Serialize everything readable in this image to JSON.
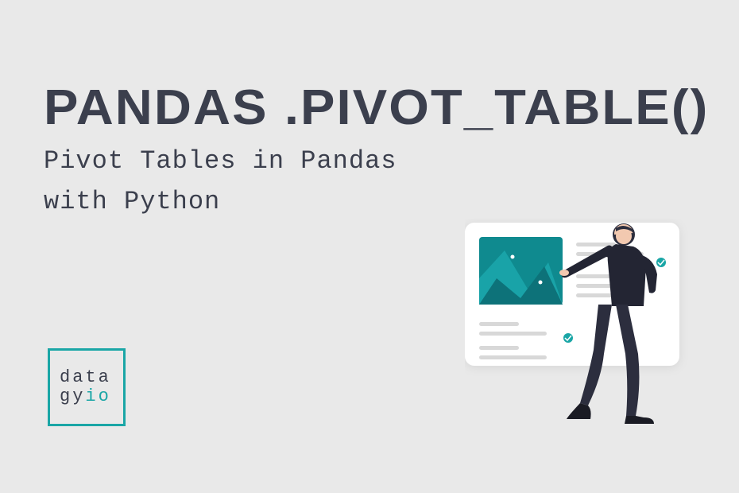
{
  "header": {
    "title": "PANDAS .PIVOT_TABLE()",
    "subtitle_line1": "Pivot Tables in Pandas",
    "subtitle_line2": "with Python"
  },
  "logo": {
    "line1": "data",
    "line2_part1": "gy",
    "line2_part2": "io"
  },
  "colors": {
    "background": "#e9e9e9",
    "text_primary": "#3b3f4d",
    "accent_teal": "#1aa6a6"
  }
}
